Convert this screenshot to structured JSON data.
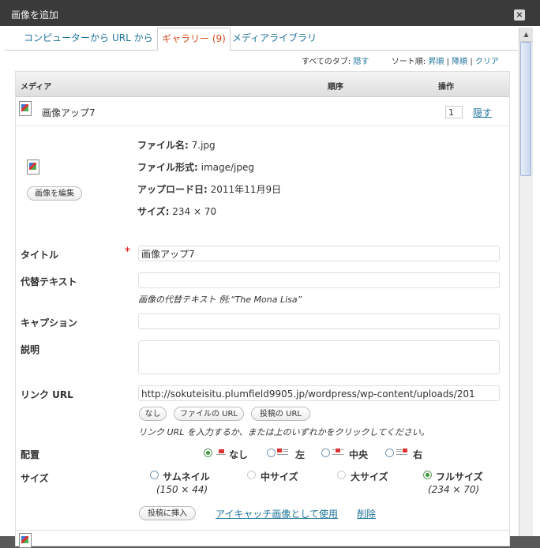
{
  "window": {
    "title": "画像を追加",
    "close_label": "×"
  },
  "tabs": [
    {
      "label": "コンピューターから"
    },
    {
      "label": "URL から"
    },
    {
      "label": "ギャラリー (9)"
    },
    {
      "label": "メディアライブラリ"
    }
  ],
  "sortbar": {
    "all_tabs_label": "すべてのタブ:",
    "hide_link": "隠す",
    "sort_label": "ソート順:",
    "asc": "昇順",
    "sep": "|",
    "desc": "降順",
    "clear": "クリア"
  },
  "table": {
    "col_media": "メディア",
    "col_order": "順序",
    "col_action": "操作"
  },
  "item": {
    "name": "画像アップ7",
    "order": "1",
    "hide_link": "隠す",
    "edit_image_button": "画像を編集",
    "filename_label": "ファイル名:",
    "filename": "7.jpg",
    "filetype_label": "ファイル形式:",
    "filetype": "image/jpeg",
    "upload_label": "アップロード日:",
    "upload_date": "2011年11月9日",
    "size_label": "サイズ:",
    "size": "234 × 70"
  },
  "form": {
    "title_label": "タイトル",
    "required_mark": "*",
    "title_value": "画像アップ7",
    "alt_label": "代替テキスト",
    "alt_value": "",
    "alt_help": "画像の代替テキスト 例:“The Mona Lisa”",
    "caption_label": "キャプション",
    "caption_value": "",
    "desc_label": "説明",
    "desc_value": "",
    "link_label": "リンク URL",
    "link_value": "http://sokuteisitu.plumfield9905.jp/wordpress/wp-content/uploads/201",
    "link_none": "なし",
    "link_file": "ファイルの URL",
    "link_post": "投稿の URL",
    "link_help": "リンク URL を入力するか、または上のいずれかをクリックしてください。",
    "align_label": "配置",
    "align_options": [
      {
        "label": "なし",
        "checked": true
      },
      {
        "label": "左",
        "checked": false
      },
      {
        "label": "中央",
        "checked": false
      },
      {
        "label": "右",
        "checked": false
      }
    ],
    "size_label": "サイズ",
    "size_options": [
      {
        "label": "サムネイル",
        "dims": "(150 × 44)",
        "checked": false,
        "enabled": true
      },
      {
        "label": "中サイズ",
        "dims": "",
        "checked": false,
        "enabled": false
      },
      {
        "label": "大サイズ",
        "dims": "",
        "checked": false,
        "enabled": false
      },
      {
        "label": "フルサイズ",
        "dims": "(234 × 70)",
        "checked": true,
        "enabled": true
      }
    ],
    "insert_button": "投稿に挿入",
    "featured_link": "アイキャッチ画像として使用",
    "delete_link": "削除"
  },
  "colors": {
    "link": "#21759b",
    "active_tab": "#d54e21",
    "titlebar": "#3a3a3a"
  }
}
